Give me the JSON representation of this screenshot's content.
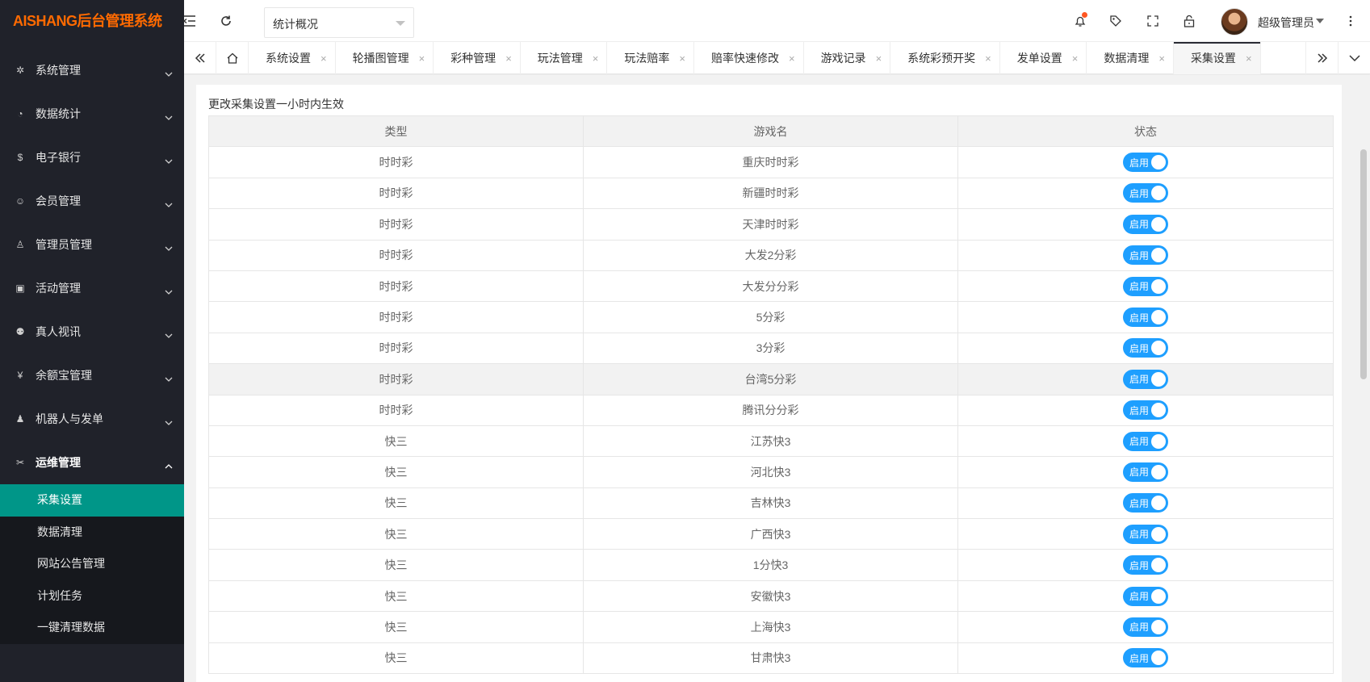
{
  "app": {
    "logo": "AISHANG后台管理系统"
  },
  "sidebar": {
    "items": [
      {
        "icon": "gear-icon",
        "glyph": "✲",
        "label": "系统管理"
      },
      {
        "icon": "dashboard-icon",
        "glyph": "◔",
        "label": "数据统计"
      },
      {
        "icon": "dollar-icon",
        "glyph": "$",
        "label": "电子银行"
      },
      {
        "icon": "user-group-icon",
        "glyph": "☺",
        "label": "会员管理"
      },
      {
        "icon": "user-icon",
        "glyph": "♙",
        "label": "管理员管理"
      },
      {
        "icon": "gift-icon",
        "glyph": "▣",
        "label": "活动管理"
      },
      {
        "icon": "users-icon",
        "glyph": "⚉",
        "label": "真人视讯"
      },
      {
        "icon": "yen-icon",
        "glyph": "¥",
        "label": "余额宝管理"
      },
      {
        "icon": "person-icon",
        "glyph": "♟",
        "label": "机器人与发单"
      },
      {
        "icon": "tools-icon",
        "glyph": "✂",
        "label": "运维管理"
      }
    ],
    "submenu": [
      "采集设置",
      "数据清理",
      "网站公告管理",
      "计划任务",
      "一键清理数据"
    ]
  },
  "header": {
    "select_value": "统计概况",
    "user_name": "超级管理员"
  },
  "tabs": [
    "系统设置",
    "轮播图管理",
    "彩种管理",
    "玩法管理",
    "玩法赔率",
    "赔率快速修改",
    "游戏记录",
    "系统彩预开奖",
    "发单设置",
    "数据清理",
    "采集设置"
  ],
  "tab_close": "×",
  "main": {
    "note": "更改采集设置一小时内生效",
    "columns": [
      "类型",
      "游戏名",
      "状态"
    ],
    "switch_label": "启用",
    "rows": [
      [
        "时时彩",
        "重庆时时彩"
      ],
      [
        "时时彩",
        "新疆时时彩"
      ],
      [
        "时时彩",
        "天津时时彩"
      ],
      [
        "时时彩",
        "大发2分彩"
      ],
      [
        "时时彩",
        "大发分分彩"
      ],
      [
        "时时彩",
        "5分彩"
      ],
      [
        "时时彩",
        "3分彩"
      ],
      [
        "时时彩",
        "台湾5分彩"
      ],
      [
        "时时彩",
        "腾讯分分彩"
      ],
      [
        "快三",
        "江苏快3"
      ],
      [
        "快三",
        "河北快3"
      ],
      [
        "快三",
        "吉林快3"
      ],
      [
        "快三",
        "广西快3"
      ],
      [
        "快三",
        "1分快3"
      ],
      [
        "快三",
        "安徽快3"
      ],
      [
        "快三",
        "上海快3"
      ],
      [
        "快三",
        "甘肃快3"
      ]
    ]
  },
  "colors": {
    "sidebar": "#20222a",
    "accent": "#009688",
    "switch_on": "#1e9fff",
    "logo": "#ff6a00",
    "notify": "#ff5722"
  }
}
